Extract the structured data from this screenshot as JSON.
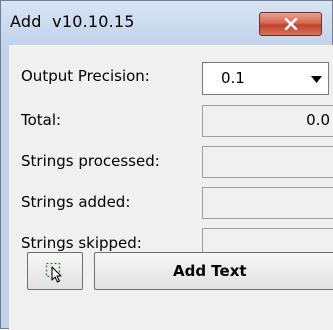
{
  "window": {
    "title": "Add  v10.10.15",
    "close_icon": "close-x-icon"
  },
  "form": {
    "precision_label": "Output Precision:",
    "precision_value": "0.1",
    "total_label": "Total:",
    "total_value": "0.0",
    "strings_processed_label": "Strings processed:",
    "strings_processed_value": "",
    "strings_added_label": "Strings added:",
    "strings_added_value": "",
    "strings_skipped_label": "Strings skipped:",
    "strings_skipped_value": ""
  },
  "buttons": {
    "pick_icon": "cursor-pick-icon",
    "add_text_label": "Add Text"
  },
  "colors": {
    "title_bar": "#c6d6ec",
    "close_button": "#c7503a",
    "background": "#f0f0f0"
  }
}
